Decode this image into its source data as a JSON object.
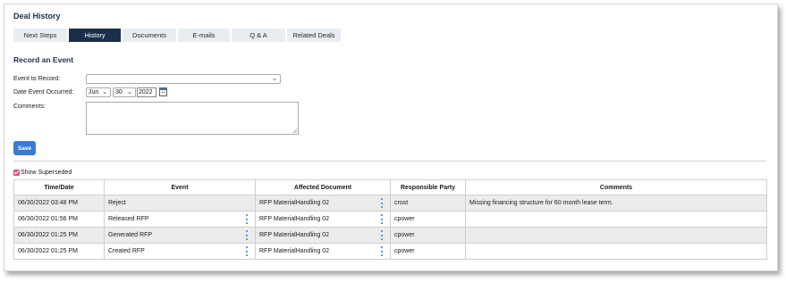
{
  "header": {
    "title": "Deal History"
  },
  "tabs": [
    {
      "label": "Next Steps",
      "active": false
    },
    {
      "label": "History",
      "active": true
    },
    {
      "label": "Documents",
      "active": false
    },
    {
      "label": "E-mails",
      "active": false
    },
    {
      "label": "Q & A",
      "active": false
    },
    {
      "label": "Related Deals",
      "active": false
    }
  ],
  "form": {
    "section_title": "Record an Event",
    "event_label": "Event to Record:",
    "event_value": "",
    "date_label": "Date Event Occurred:",
    "month": "Jun",
    "day": "30",
    "year": "2022",
    "comments_label": "Comments:",
    "comments_value": "",
    "save_label": "Save"
  },
  "show_superseded": {
    "label": "Show Superseded",
    "checked": true
  },
  "table": {
    "headers": [
      "Time/Date",
      "Event",
      "Affected Document",
      "Responsible Party",
      "Comments"
    ],
    "rows": [
      {
        "time": "06/30/2022 03:48 PM",
        "event": "Reject",
        "event_menu": false,
        "document": "RFP MaterialHandling 02",
        "party": "crost",
        "comments": "Missing financing structure for 60 month lease term."
      },
      {
        "time": "06/30/2022 01:56 PM",
        "event": "Released RFP",
        "event_menu": true,
        "document": "RFP MaterialHandling 02",
        "party": "cpower",
        "comments": ""
      },
      {
        "time": "06/30/2022 01:25 PM",
        "event": "Generated RFP",
        "event_menu": true,
        "document": "RFP MaterialHandling 02",
        "party": "cpower",
        "comments": ""
      },
      {
        "time": "06/30/2022 01:25 PM",
        "event": "Created RFP",
        "event_menu": true,
        "document": "RFP MaterialHandling 02",
        "party": "cpower",
        "comments": ""
      }
    ]
  },
  "colors": {
    "brand_navy": "#1c2f4a",
    "tab_bg": "#e8edf2",
    "save_blue": "#3b7bd4",
    "checkbox_pink": "#e0557a",
    "kebab_blue": "#3a78c9"
  },
  "icons": {
    "calendar": "calendar-icon",
    "menu": "kebab-menu-icon",
    "dropdown": "chevron-down-icon"
  }
}
